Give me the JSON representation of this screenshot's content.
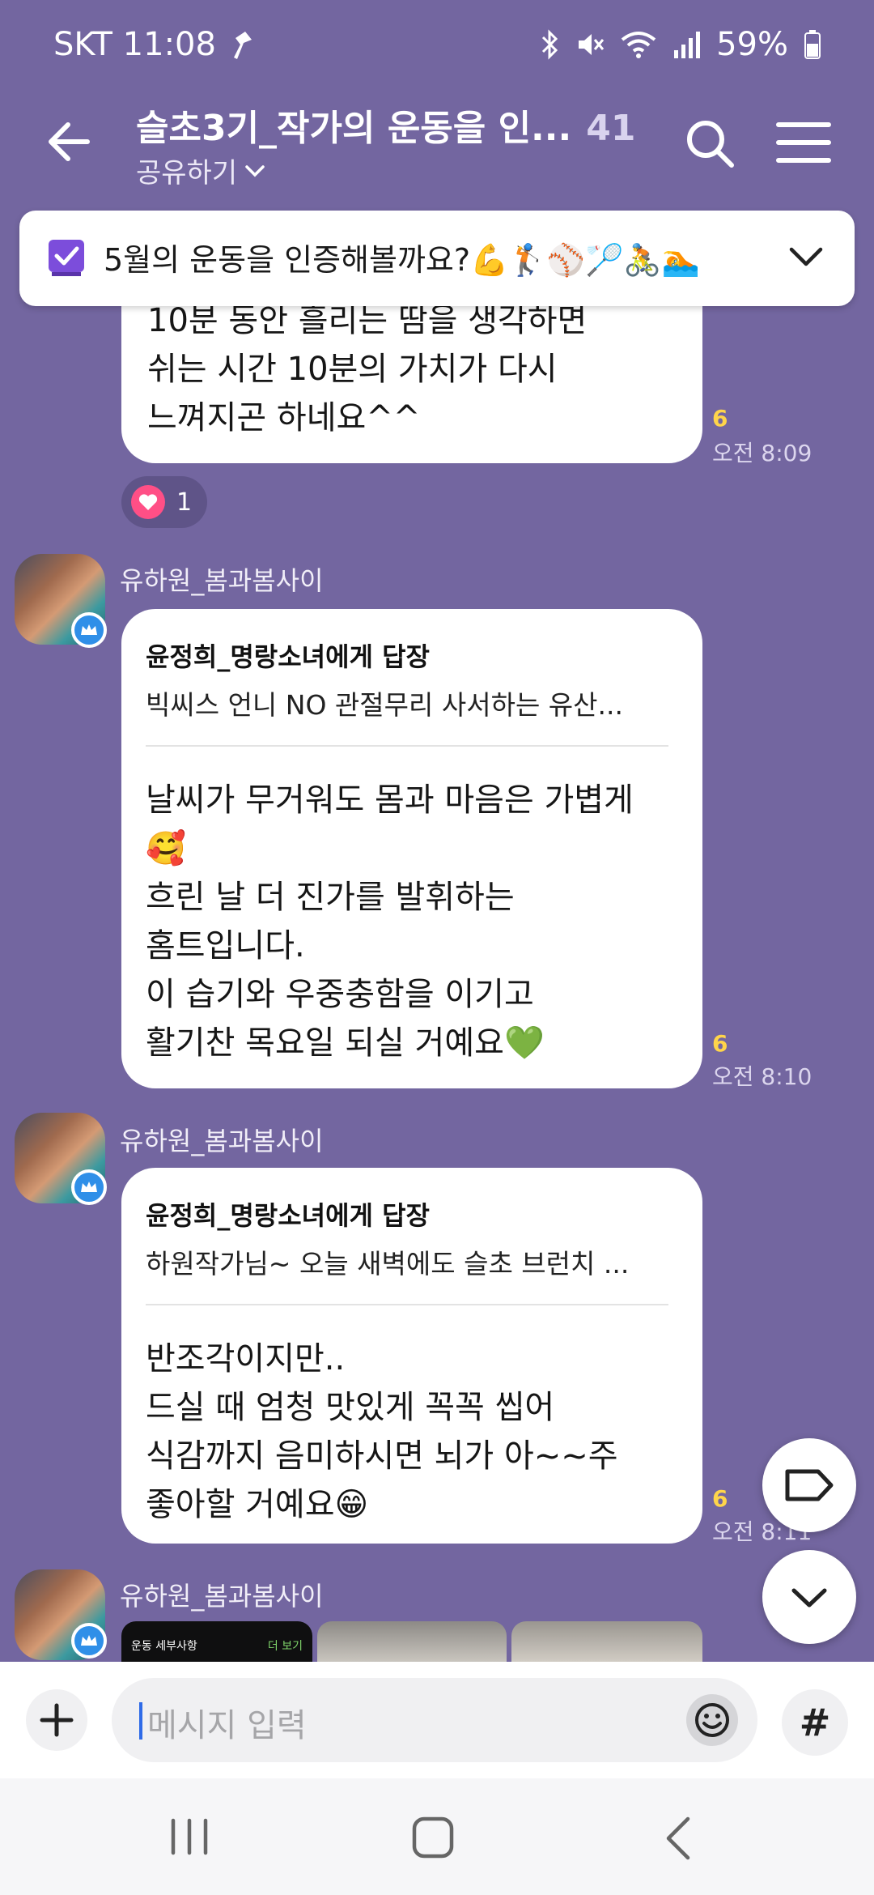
{
  "status_bar": {
    "carrier_time": "SKT 11:08",
    "battery": "59%",
    "icons": [
      "pin-icon",
      "bluetooth-icon",
      "mute-icon",
      "wifi-icon",
      "signal-icon",
      "battery-icon"
    ]
  },
  "header": {
    "title": "슬초3기_작가의 운동을 인...",
    "member_count": "41",
    "subtitle": "공유하기"
  },
  "notice": {
    "text": "5월의 운동을 인증해볼까요?💪🏌️⚾🏸🚴🏊"
  },
  "messages": [
    {
      "text": "10분 동안 흘리는 땀을 생각하면\n쉬는 시간 10분의 가치가 다시\n느껴지곤 하네요^^",
      "read_count": "6",
      "time": "오전 8:09",
      "reaction_count": "1"
    },
    {
      "sender": "유하원_봄과봄사이",
      "reply_to": "윤정희_명랑소녀에게 답장",
      "reply_preview": "빅씨스 언니 NO 관절무리 사서하는 유산...",
      "text": "날씨가 무거워도 몸과 마음은 가볍게\n🥰\n흐린 날 더 진가를 발휘하는\n홈트입니다.\n이 습기와 우중충함을 이기고\n활기찬 목요일 되실 거예요💚",
      "read_count": "6",
      "time": "오전 8:10"
    },
    {
      "sender": "유하원_봄과봄사이",
      "reply_to": "윤정희_명랑소녀에게 답장",
      "reply_preview": "하원작가님~ 오늘 새벽에도 슬초 브런치 ...",
      "text": "반조각이지만..\n드실 때 엄청 맛있게 꼭꼭 씹어\n식감까지 음미하시면 뇌가 아~~주\n좋아할 거예요😁",
      "read_count": "6",
      "time": "오전 8:11"
    },
    {
      "sender": "유하원_봄과봄사이",
      "image_caption_1": "운동 세부사항",
      "image_caption_2": "더 보기"
    }
  ],
  "input": {
    "placeholder": "메시지 입력",
    "hash_label": "#"
  },
  "colors": {
    "chat_background": "#7366a0",
    "read_count": "#ffd54a",
    "bubble": "#ffffff"
  }
}
